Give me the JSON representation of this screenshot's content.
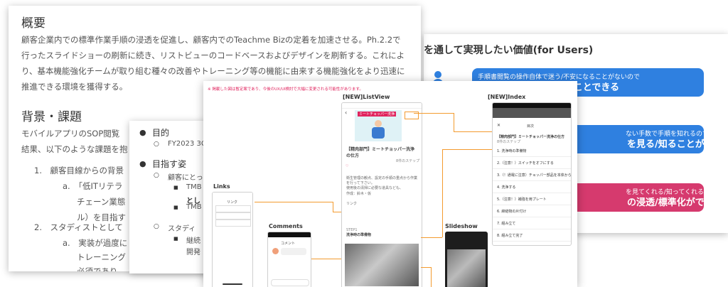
{
  "values_card": {
    "title": "を通して実現したい価値(for Users)",
    "items": [
      {
        "small": "手順書閲覧の操作自体で迷う/不安になることがないので",
        "big": "確実に手順を見る/知ることできる",
        "color": "#2f80e0"
      },
      {
        "small": "ない手数で手順を知れるので",
        "big": "を見る/知ることができる",
        "color": "#2f80e0"
      },
      {
        "small": "を見てくれる/知ってくれるので",
        "big": "の浸透/標準化ができる",
        "color": "#d63a6e"
      }
    ]
  },
  "doc": {
    "overview_heading": "概要",
    "overview_lines": [
      "顧客企業内での標準作業手順の浸透を促進し、顧客内でのTeachme Bizの定着を加速させる。Ph.2.2で",
      "行ったスライドショーの刷新に続き、リストビューのコードベースおよびデザインを刷新する。これによ",
      "り、基本機能強化チームが取り組む種々の改善やトレーニング等の機能に由来する機能強化をより迅速に",
      "推進できる環境を獲得する。"
    ],
    "bg_heading": "背景・課題",
    "bg_lines": [
      "モバイルアプリのSOP閲覧",
      "結果、以下のような課題を抱"
    ],
    "list_1": "1.　顧客目線からの背景",
    "list_1a": "a.　「低ITリテラ",
    "list_1a_2": "チェーン業態",
    "list_1a_3": "ル）を目指す",
    "list_2": "2.　スタディストとして",
    "list_2a": "a.　実装が過度に",
    "list_2a_2": "トレーニング",
    "list_2a_3": "必須であり、"
  },
  "outline": {
    "purpose": "目的",
    "purpose_sub": "FY2023 3C",
    "ideal": "目指す姿",
    "ideal_sub": "顧客にとっ",
    "ideal_b1": "TMB",
    "ideal_b1_2": "とし",
    "ideal_b2": "TMB",
    "studyist": "スタディ",
    "studyist_b": "継続",
    "studyist_b2": "開発"
  },
  "screens": {
    "notice": "※ 掲載した図は暫定案であり、今後のUX/UI検討で大幅に変更される可能性があります。",
    "listview_label": "[NEW]ListView",
    "index_label": "[NEW]Index",
    "links_label": "Links",
    "comments_label": "Comments",
    "slideshow_label": "Slideshow",
    "lv_banner": "ミートチョッパー洗浄",
    "lv_title": "【精肉部門】ミートチョッパー洗浄の仕方",
    "lv_meta": "8件のステップ",
    "lv_desc1": "衛生管理の観点、設定の手順の重点から作業を行って下さい。",
    "lv_desc2": "使用後の清掃に必要な道具なども、",
    "lv_author": "作成：鈴木・仮",
    "lv_link": "リンク",
    "lv_step_no": "STEP1",
    "lv_step_title": "洗浄時の準備物",
    "index_title": "目次",
    "index_head": "【精肉部門】ミートチョッパー洗浄の仕方",
    "index_meta": "8件のステップ",
    "index_items": [
      "1. 洗浄時の準備物",
      "2.（注意！）スイッチをオフにする",
      "3.（！通電に注意）チョッパー部品を本体から取り外す",
      "4. 洗浄する",
      "5.（注意！）補強を用プレート",
      "6. 締結物の片付け",
      "7. 組み立て",
      "8. 組み立て完了",
      "9. 最終確認"
    ],
    "links_header": "リンク",
    "comments_header": "コメント",
    "footer_comment": "コメント"
  }
}
